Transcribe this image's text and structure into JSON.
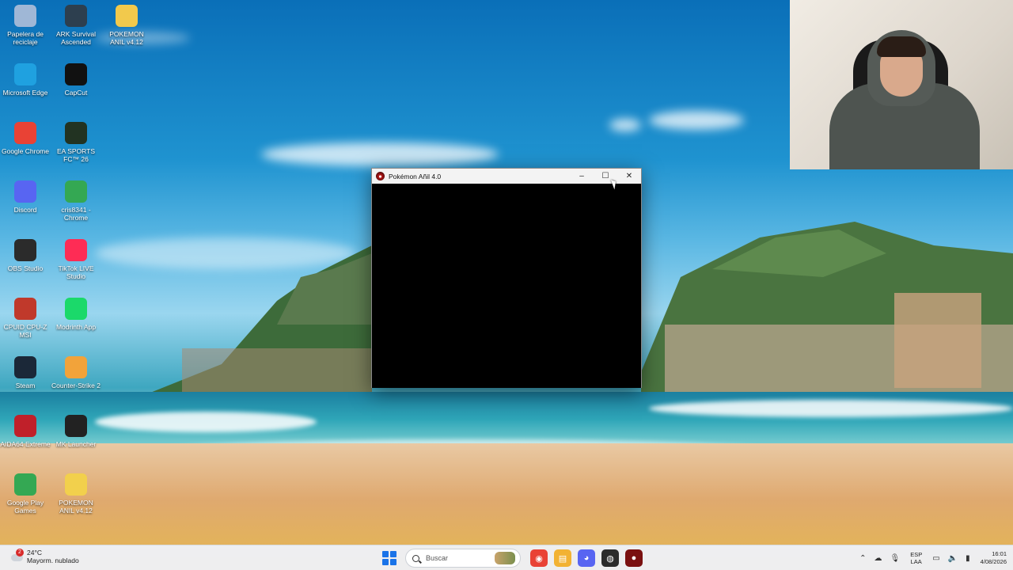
{
  "desktop": {
    "icons": [
      {
        "label": "Papelera de reciclaje",
        "icon": "recycle-bin-icon",
        "color": "#9fb7d6"
      },
      {
        "label": "ARK Survival Ascended",
        "icon": "ark-icon",
        "color": "#2d3f4f"
      },
      {
        "label": "POKEMON ANIL v4.12",
        "icon": "folder-icon",
        "color": "#f2c94c"
      },
      {
        "label": "Microsoft Edge",
        "icon": "edge-icon",
        "color": "#1fa1e0"
      },
      {
        "label": "CapCut",
        "icon": "capcut-icon",
        "color": "#111111"
      },
      {
        "label": "Google Chrome",
        "icon": "chrome-icon",
        "color": "#e94235"
      },
      {
        "label": "EA SPORTS FC™ 26",
        "icon": "ea-fc-icon",
        "color": "#223322"
      },
      {
        "label": "Discord",
        "icon": "discord-icon",
        "color": "#5865f2"
      },
      {
        "label": "cris8341 - Chrome",
        "icon": "chrome-profile-icon",
        "color": "#34a853"
      },
      {
        "label": "OBS Studio",
        "icon": "obs-icon",
        "color": "#2b2b2b"
      },
      {
        "label": "TikTok LIVE Studio",
        "icon": "tiktok-icon",
        "color": "#fe2c55"
      },
      {
        "label": "CPUID CPU-Z MSI",
        "icon": "cpuz-icon",
        "color": "#c0392b"
      },
      {
        "label": "Modrinth App",
        "icon": "modrinth-icon",
        "color": "#1bd96a"
      },
      {
        "label": "Steam",
        "icon": "steam-icon",
        "color": "#1b2838"
      },
      {
        "label": "Counter-Strike 2",
        "icon": "cs2-icon",
        "color": "#f2a33a"
      },
      {
        "label": "AIDA64 Extreme",
        "icon": "aida64-icon",
        "color": "#c0202a"
      },
      {
        "label": "MK Launcher",
        "icon": "mk-launcher-icon",
        "color": "#222222"
      },
      {
        "label": "Google Play Games",
        "icon": "play-games-icon",
        "color": "#34a853"
      },
      {
        "label": "POKEMON ANIL v4.12",
        "icon": "folder-zip-icon",
        "color": "#f2d04c"
      }
    ]
  },
  "window": {
    "title": "Pokémon Añil 4.0",
    "minimize": "–",
    "maximize": "☐",
    "close": "✕"
  },
  "taskbar": {
    "weather": {
      "temp": "24°C",
      "desc": "Mayorm. nublado",
      "badge": "2"
    },
    "search_placeholder": "Buscar",
    "apps": [
      {
        "icon": "chrome-taskbar-icon",
        "glyph": "◉",
        "color": "#e94235"
      },
      {
        "icon": "file-explorer-icon",
        "glyph": "▤",
        "color": "#f2b233"
      },
      {
        "icon": "discord-taskbar-icon",
        "glyph": "◕",
        "color": "#5865f2"
      },
      {
        "icon": "obs-taskbar-icon",
        "glyph": "◍",
        "color": "#2b2b2b"
      },
      {
        "icon": "pokemon-taskbar-icon",
        "glyph": "●",
        "color": "#7a1010"
      }
    ],
    "tray": {
      "lang_top": "ESP",
      "lang_bottom": "LAA",
      "time": "16:01",
      "date": "4/08/2026"
    }
  }
}
